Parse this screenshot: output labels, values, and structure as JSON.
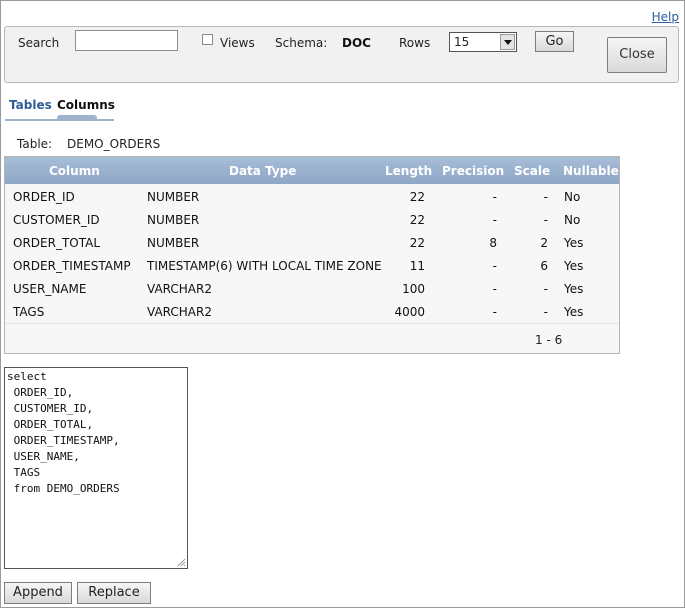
{
  "header": {
    "help_label": "Help"
  },
  "toolbar": {
    "search_label": "Search",
    "search_value": "",
    "views_label": "Views",
    "views_checked": false,
    "schema_label": "Schema:",
    "schema_value": "DOC",
    "rows_label": "Rows",
    "rows_value": "15",
    "go_label": "Go",
    "close_label": "Close"
  },
  "tabs": [
    {
      "label": "Tables",
      "active": false
    },
    {
      "label": "Columns",
      "active": true
    }
  ],
  "table_info": {
    "label": "Table:",
    "name": "DEMO_ORDERS"
  },
  "grid": {
    "headers": [
      "Column",
      "Data Type",
      "Length",
      "Precision",
      "Scale",
      "Nullable"
    ],
    "rows": [
      [
        "ORDER_ID",
        "NUMBER",
        "22",
        "-",
        "-",
        "No"
      ],
      [
        "CUSTOMER_ID",
        "NUMBER",
        "22",
        "-",
        "-",
        "No"
      ],
      [
        "ORDER_TOTAL",
        "NUMBER",
        "22",
        "8",
        "2",
        "Yes"
      ],
      [
        "ORDER_TIMESTAMP",
        "TIMESTAMP(6) WITH LOCAL TIME ZONE",
        "11",
        "-",
        "6",
        "Yes"
      ],
      [
        "USER_NAME",
        "VARCHAR2",
        "100",
        "-",
        "-",
        "Yes"
      ],
      [
        "TAGS",
        "VARCHAR2",
        "4000",
        "-",
        "-",
        "Yes"
      ]
    ],
    "pagination": "1 - 6"
  },
  "sql": {
    "text": "select\n ORDER_ID,\n CUSTOMER_ID,\n ORDER_TOTAL,\n ORDER_TIMESTAMP,\n USER_NAME,\n TAGS\n from DEMO_ORDERS"
  },
  "actions": {
    "append_label": "Append",
    "replace_label": "Replace"
  },
  "colors": {
    "header_bg": "#9bb2d0",
    "tab_active": "#2f5e93",
    "link": "#2b5da0"
  }
}
